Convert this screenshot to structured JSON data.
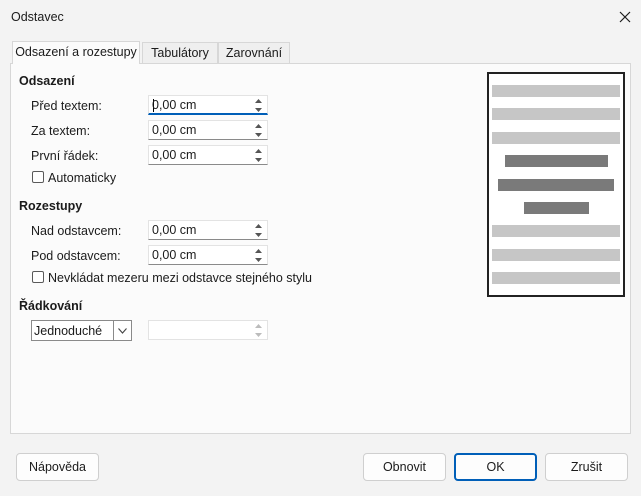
{
  "window": {
    "title": "Odstavec"
  },
  "tabs": [
    "Odsazení a rozestupy",
    "Tabulátory",
    "Zarovnání"
  ],
  "indent": {
    "heading": "Odsazení",
    "before_label": "Před textem:",
    "before_value": "0,00 cm",
    "after_label": "Za textem:",
    "after_value": "0,00 cm",
    "first_label": "První řádek:",
    "first_value": "0,00 cm",
    "auto_label": "Automaticky"
  },
  "spacing": {
    "heading": "Rozestupy",
    "above_label": "Nad odstavcem:",
    "above_value": "0,00 cm",
    "below_label": "Pod odstavcem:",
    "below_value": "0,00 cm",
    "no_space_label": "Nevkládat mezeru mezi odstavce stejného stylu"
  },
  "line_spacing": {
    "heading": "Řádkování",
    "selected": "Jednoduché",
    "value": ""
  },
  "buttons": {
    "help": "Nápověda",
    "reset": "Obnovit",
    "ok": "OK",
    "cancel": "Zrušit"
  },
  "colors": {
    "preview_light": "#c6c6c6",
    "preview_dark": "#7a7a7a",
    "accent": "#005fb8"
  }
}
